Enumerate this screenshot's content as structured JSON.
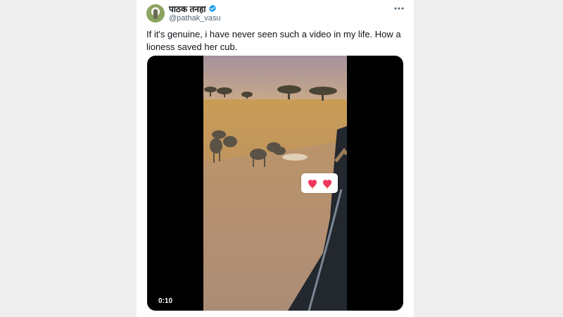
{
  "post": {
    "author": {
      "display_name": "पाठक तनहा",
      "handle": "@pathak_vasu",
      "verified": true
    },
    "text": "If it's genuine, i have never seen such a video in my life. How a lioness saved her cub.",
    "media": {
      "type": "video",
      "timestamp": "0:10",
      "overlay_emoji": "❤️❤️"
    },
    "icons": {
      "more": "more-options-icon",
      "verified": "verified-badge-icon"
    }
  },
  "colors": {
    "accent_blue": "#1d9bf0",
    "text_primary": "#0f1419",
    "text_secondary": "#536471",
    "page_background": "#eeeeee"
  }
}
